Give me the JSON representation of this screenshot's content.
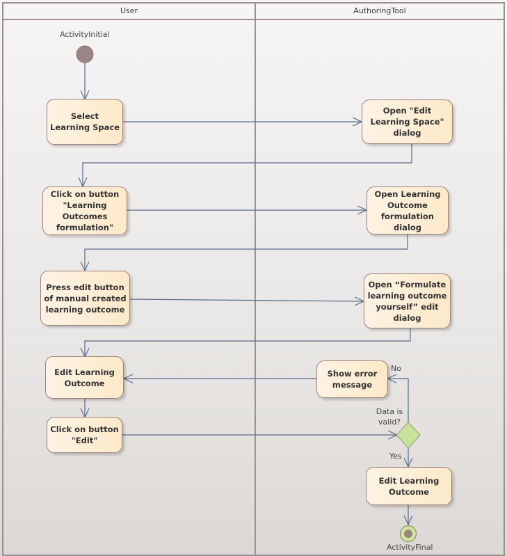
{
  "diagram": {
    "type": "uml-activity-diagram",
    "lanes": [
      {
        "id": "user",
        "title": "User"
      },
      {
        "id": "tool",
        "title": "AuthoringTool"
      }
    ],
    "initial": {
      "label": "ActivityInitial"
    },
    "final": {
      "label": "ActivityFinal"
    },
    "actions": {
      "select_space": "Select Learning Space",
      "open_edit_space": "Open \"Edit Learning Space\" dialog",
      "click_lo_formulation": "Click on button \"Learning Outcomes formulation\"",
      "open_lo_formulation": "Open Learning Outcome formulation dialog",
      "press_edit_manual": "Press edit button of manual created learning outcome",
      "open_formulate_yourself": "Open “Formulate learning outcome yourself”  edit dialog",
      "edit_lo_user": "Edit Learning Outcome",
      "click_edit": "Click on button \"Edit\"",
      "show_error": "Show error message",
      "edit_lo_tool": "Edit Learning Outcome"
    },
    "decision": {
      "label": "Data is valid?",
      "no_label": "No",
      "yes_label": "Yes"
    },
    "flows": [
      [
        "initial",
        "select_space"
      ],
      [
        "select_space",
        "open_edit_space"
      ],
      [
        "open_edit_space",
        "click_lo_formulation"
      ],
      [
        "click_lo_formulation",
        "open_lo_formulation"
      ],
      [
        "open_lo_formulation",
        "press_edit_manual"
      ],
      [
        "press_edit_manual",
        "open_formulate_yourself"
      ],
      [
        "open_formulate_yourself",
        "edit_lo_user"
      ],
      [
        "edit_lo_user",
        "click_edit"
      ],
      [
        "click_edit",
        "decision"
      ],
      [
        "decision",
        "show_error",
        "No"
      ],
      [
        "show_error",
        "edit_lo_user"
      ],
      [
        "decision",
        "edit_lo_tool",
        "Yes"
      ],
      [
        "edit_lo_tool",
        "final"
      ]
    ],
    "colors": {
      "action_fill_start": "#fdf3e4",
      "action_fill_end": "#fde9c8",
      "action_border": "#9a7e78",
      "edge": "#5a6a8a",
      "initial_node": "#9a8584",
      "decision_fill": "#c8e29c",
      "lane_border": "#9c8f92"
    }
  }
}
